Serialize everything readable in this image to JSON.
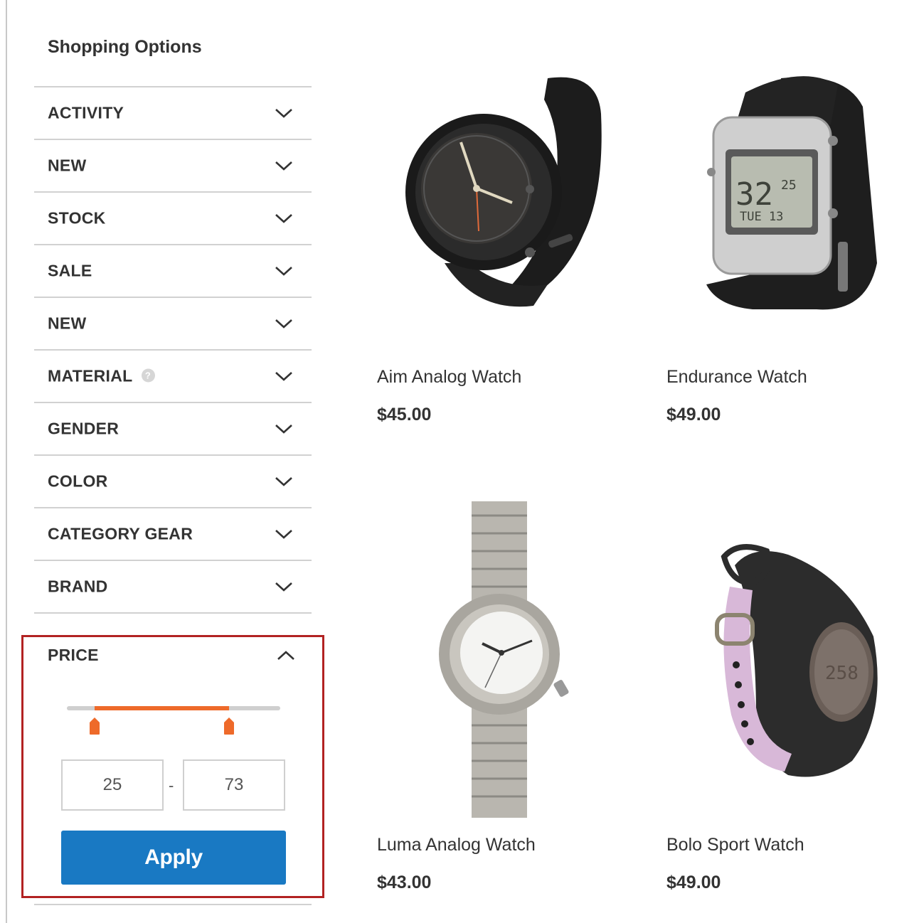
{
  "sidebar": {
    "title": "Shopping Options",
    "filters": [
      {
        "label": "ACTIVITY",
        "icon": "chevron-down-icon"
      },
      {
        "label": "NEW",
        "icon": "chevron-down-icon"
      },
      {
        "label": "STOCK",
        "icon": "chevron-down-icon"
      },
      {
        "label": "SALE",
        "icon": "chevron-down-icon"
      },
      {
        "label": "NEW",
        "icon": "chevron-down-icon"
      },
      {
        "label": "MATERIAL",
        "icon": "chevron-down-icon",
        "help_icon": "question-mark-icon",
        "help_glyph": "?"
      },
      {
        "label": "GENDER",
        "icon": "chevron-down-icon"
      },
      {
        "label": "COLOR",
        "icon": "chevron-down-icon"
      },
      {
        "label": "CATEGORY GEAR",
        "icon": "chevron-down-icon"
      },
      {
        "label": "BRAND",
        "icon": "chevron-down-icon"
      }
    ],
    "price": {
      "label": "PRICE",
      "icon": "chevron-up-icon",
      "min": "25",
      "separator": "-",
      "max": "73",
      "slider_range_fraction": [
        0.13,
        0.76
      ],
      "apply_label": "Apply"
    }
  },
  "products": [
    {
      "name": "Aim Analog Watch",
      "price": "$45.00",
      "image": "black-analog-watch"
    },
    {
      "name": "Endurance Watch",
      "price": "$49.00",
      "image": "silver-digital-watch"
    },
    {
      "name": "Luma Analog Watch",
      "price": "$43.00",
      "image": "steel-link-analog-watch"
    },
    {
      "name": "Bolo Sport Watch",
      "price": "$49.00",
      "image": "pink-black-sport-watch"
    }
  ],
  "colors": {
    "accent": "#1979c3",
    "slider": "#ee6a2a",
    "highlight_border": "#b22222",
    "text": "#333333",
    "divider": "#d1d1d1"
  }
}
